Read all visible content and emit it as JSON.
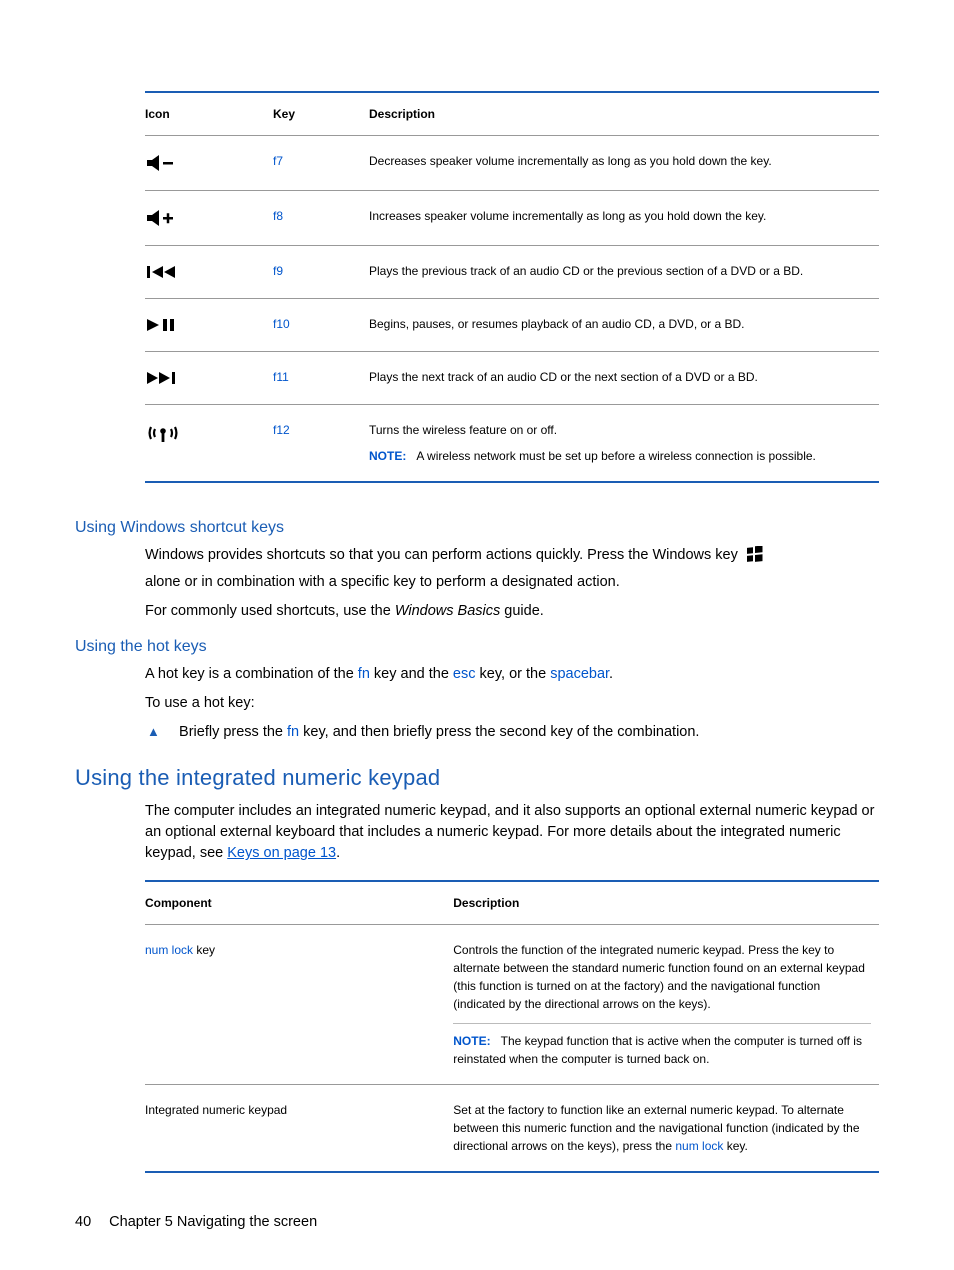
{
  "table1": {
    "headers": {
      "icon": "Icon",
      "key": "Key",
      "desc": "Description"
    },
    "rows": [
      {
        "key": "f7",
        "desc": "Decreases speaker volume incrementally as long as you hold down the key.",
        "icon": "volume-down-icon"
      },
      {
        "key": "f8",
        "desc": "Increases speaker volume incrementally as long as you hold down the key.",
        "icon": "volume-up-icon"
      },
      {
        "key": "f9",
        "desc": "Plays the previous track of an audio CD or the previous section of a DVD or a BD.",
        "icon": "previous-track-icon"
      },
      {
        "key": "f10",
        "desc": "Begins, pauses, or resumes playback of an audio CD, a DVD, or a BD.",
        "icon": "play-pause-icon"
      },
      {
        "key": "f11",
        "desc": "Plays the next track of an audio CD or the next section of a DVD or a BD.",
        "icon": "next-track-icon"
      },
      {
        "key": "f12",
        "desc": "Turns the wireless feature on or off.",
        "icon": "wireless-icon",
        "note_label": "NOTE:",
        "note": "A wireless network must be set up before a wireless connection is possible."
      }
    ]
  },
  "sections": {
    "winshort": {
      "title": "Using Windows shortcut keys",
      "p1a": "Windows provides shortcuts so that you can perform actions quickly. Press the Windows key",
      "p1b": "alone or in combination with a specific key to perform a designated action.",
      "p2a": "For commonly used shortcuts, use the ",
      "p2_italic": "Windows Basics",
      "p2b": " guide."
    },
    "hotkeys": {
      "title": "Using the hot keys",
      "p1_parts": [
        "A hot key is a combination of the ",
        "fn",
        " key and the ",
        "esc",
        " key, or the ",
        "spacebar",
        "."
      ],
      "p2": "To use a hot key:",
      "bullet_parts": [
        "Briefly press the ",
        "fn",
        " key, and then briefly press the second key of the combination."
      ]
    },
    "keypad": {
      "title": "Using the integrated numeric keypad",
      "intro_parts": [
        "The computer includes an integrated numeric keypad, and it also supports an optional external numeric keypad or an optional external keyboard that includes a numeric keypad. For more details about the integrated numeric keypad, see ",
        "Keys on page 13",
        "."
      ]
    }
  },
  "table2": {
    "headers": {
      "comp": "Component",
      "desc": "Description"
    },
    "rows": [
      {
        "comp_pre": "num lock",
        "comp_post": " key",
        "desc": "Controls the function of the integrated numeric keypad. Press the key to alternate between the standard numeric function found on an external keypad (this function is turned on at the factory) and the navigational function (indicated by the directional arrows on the keys).",
        "note_label": "NOTE:",
        "note": "The keypad function that is active when the computer is turned off is reinstated when the computer is turned back on."
      },
      {
        "comp": "Integrated numeric keypad",
        "desc_parts": [
          "Set at the factory to function like an external numeric keypad. To alternate between this numeric function and the navigational function (indicated by the directional arrows on the keys), press the ",
          "num lock",
          " key."
        ]
      }
    ]
  },
  "footer": {
    "page": "40",
    "chapter": "Chapter 5   Navigating the screen"
  }
}
